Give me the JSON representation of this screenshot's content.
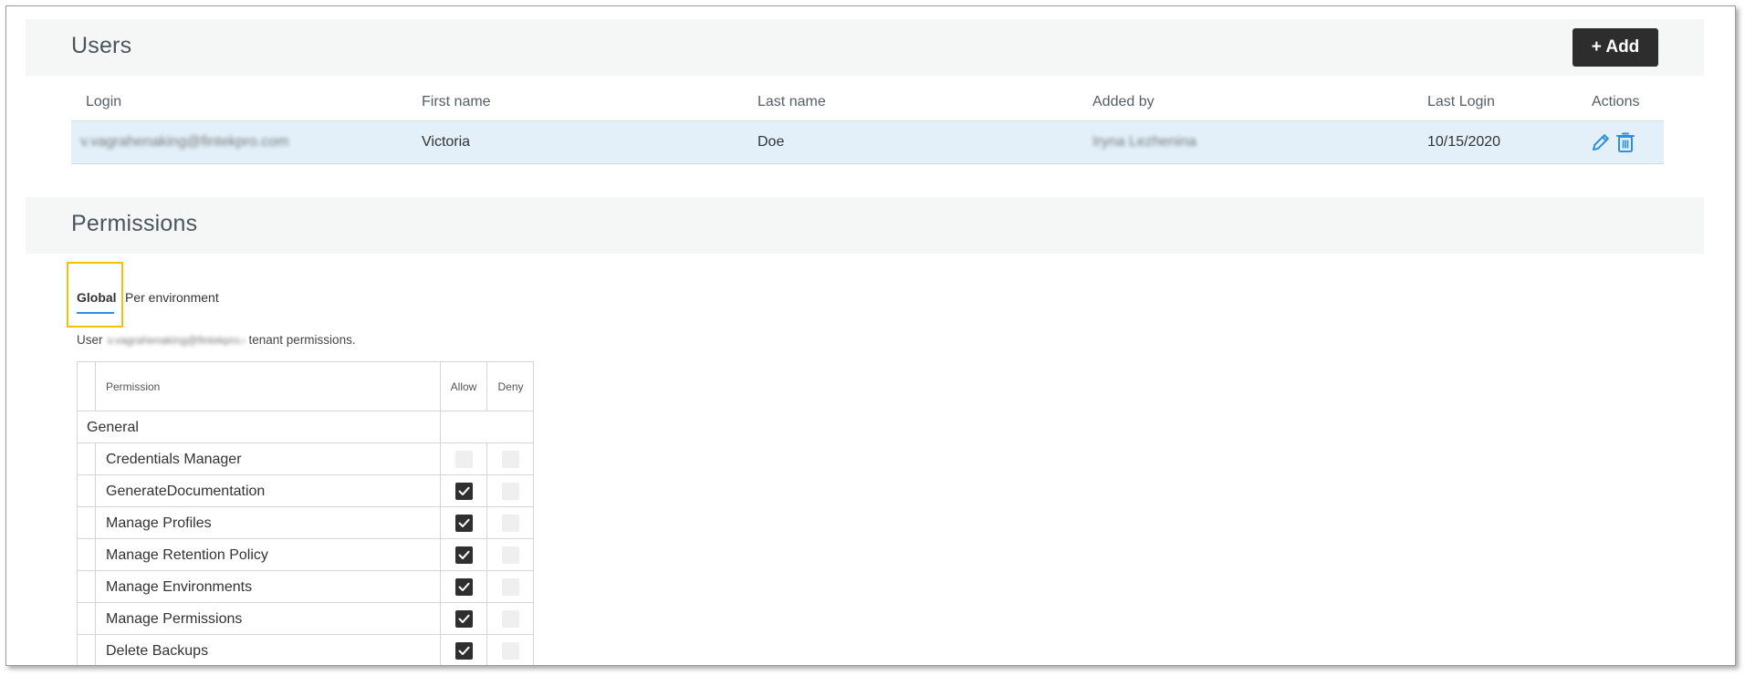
{
  "users": {
    "title": "Users",
    "add_label": "+ Add",
    "columns": {
      "login": "Login",
      "first_name": "First name",
      "last_name": "Last name",
      "added_by": "Added by",
      "last_login": "Last Login",
      "actions": "Actions"
    },
    "rows": [
      {
        "login": "v.vagrahenaking@fintekpro.com",
        "first_name": "Victoria",
        "last_name": "Doe",
        "added_by": "Iryna Lezhenina",
        "last_login": "10/15/2020"
      }
    ]
  },
  "permissions": {
    "title": "Permissions",
    "tabs": [
      "Global",
      "Per environment"
    ],
    "active_tab": "Global",
    "desc_prefix": "User",
    "desc_user": "v.vagrahenaking@fintekpro.com",
    "desc_suffix": "tenant permissions.",
    "table": {
      "headers": {
        "permission": "Permission",
        "allow": "Allow",
        "deny": "Deny"
      },
      "group": "General",
      "rows": [
        {
          "label": "Credentials Manager",
          "allow": false,
          "deny": false
        },
        {
          "label": "GenerateDocumentation",
          "allow": true,
          "deny": false
        },
        {
          "label": "Manage Profiles",
          "allow": true,
          "deny": false
        },
        {
          "label": "Manage Retention Policy",
          "allow": true,
          "deny": false
        },
        {
          "label": "Manage Environments",
          "allow": true,
          "deny": false
        },
        {
          "label": "Manage Permissions",
          "allow": true,
          "deny": false
        },
        {
          "label": "Delete Backups",
          "allow": true,
          "deny": false
        }
      ]
    }
  },
  "colors": {
    "accent": "#2f8ee0",
    "highlight": "#f3c20a",
    "row_selected": "#e3f0fa",
    "button_dark": "#2d2d2d"
  },
  "icons": {
    "edit": "pencil-icon",
    "delete": "trash-icon",
    "check": "check-icon"
  }
}
